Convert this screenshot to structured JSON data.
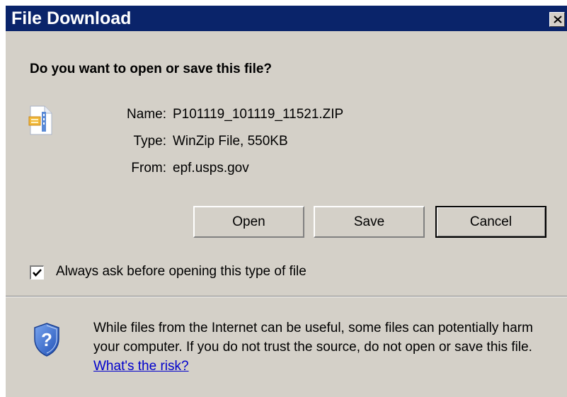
{
  "window": {
    "title": "File Download"
  },
  "dialog": {
    "question": "Do you want to open or save this file?",
    "fields": [
      {
        "label": "Name:",
        "value": "P101119_101119_11521.ZIP"
      },
      {
        "label": "Type:",
        "value": "WinZip File, 550KB"
      },
      {
        "label": "From:",
        "value": "epf.usps.gov"
      }
    ],
    "buttons": {
      "open": "Open",
      "save": "Save",
      "cancel": "Cancel"
    },
    "always_ask": {
      "label": "Always ask before opening this type of file",
      "checked": true
    },
    "warning": {
      "text": "While files from the Internet can be useful, some files can potentially harm your computer. If you do not trust the source, do not open or save this file.",
      "link": "What's the risk?"
    }
  },
  "icons": {
    "close": "close-icon",
    "file": "zip-file-icon",
    "shield": "shield-question-icon",
    "check": "checkmark-icon"
  },
  "colors": {
    "titlebar": "#0a246a",
    "dialog_bg": "#d4d0c8",
    "link": "#0000cc"
  }
}
